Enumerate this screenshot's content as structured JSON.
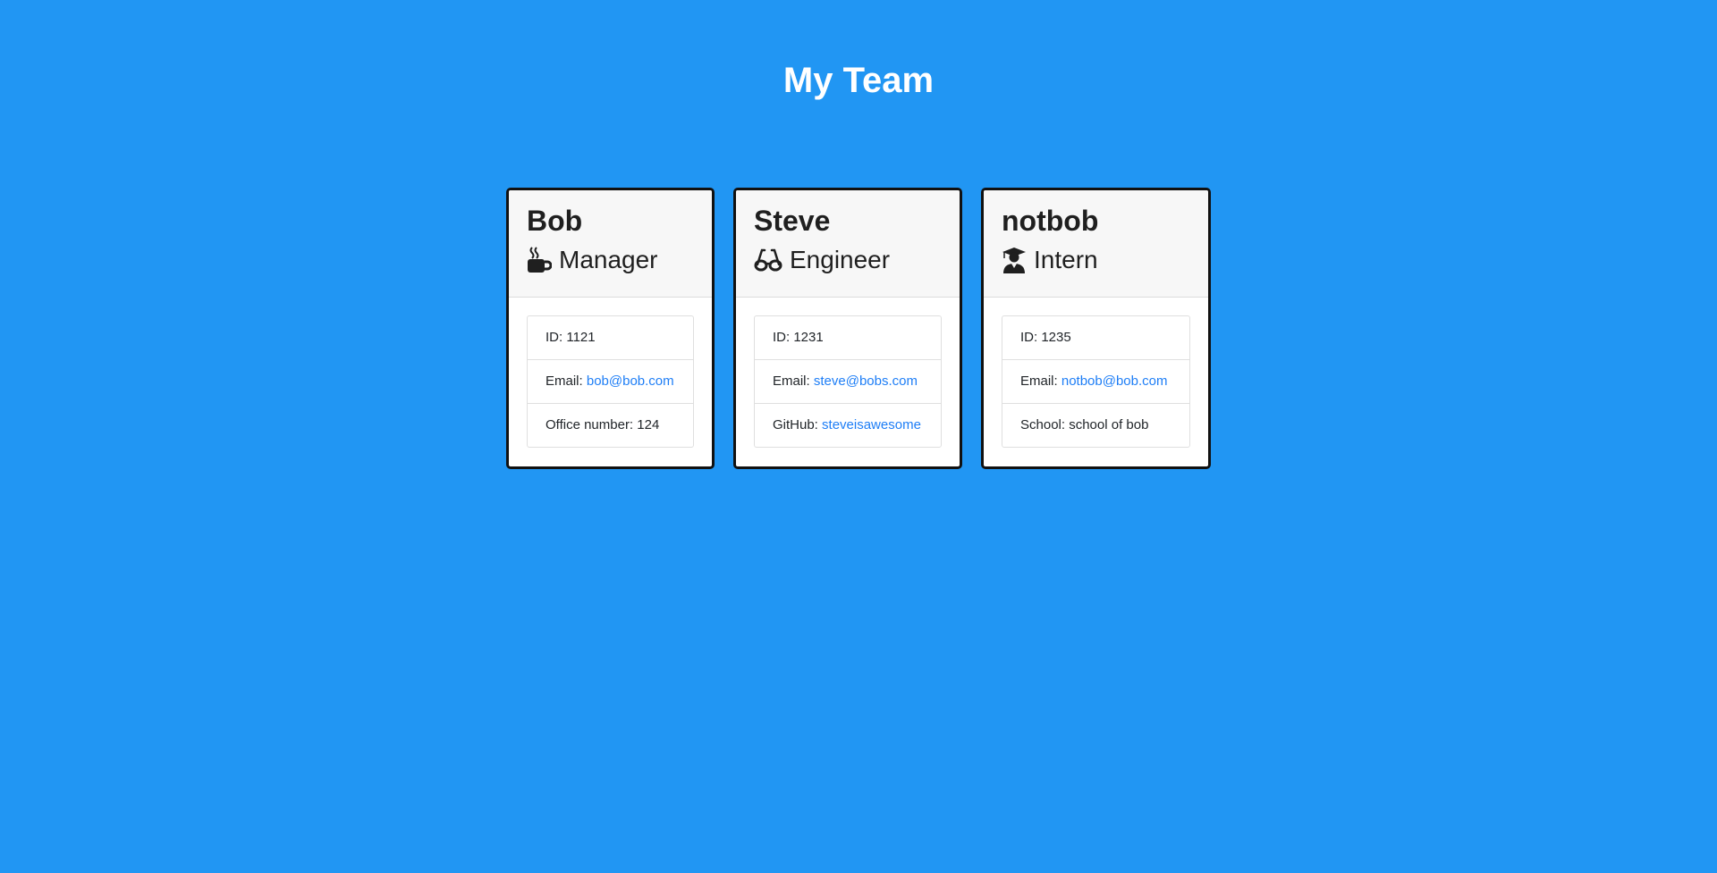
{
  "page": {
    "title": "My Team",
    "background_color": "#2196f3"
  },
  "cards": [
    {
      "name": "Bob",
      "role": "Manager",
      "role_icon": "coffee-mug-icon",
      "id_label": "ID:",
      "id_value": "1121",
      "email_label": "Email:",
      "email_value": "bob@bob.com",
      "extra_label": "Office number:",
      "extra_value": "124"
    },
    {
      "name": "Steve",
      "role": "Engineer",
      "role_icon": "glasses-icon",
      "id_label": "ID:",
      "id_value": "1231",
      "email_label": "Email:",
      "email_value": "steve@bobs.com",
      "extra_label": "GitHub:",
      "extra_value": "steveisawesome"
    },
    {
      "name": "notbob",
      "role": "Intern",
      "role_icon": "graduate-icon",
      "id_label": "ID:",
      "id_value": "1235",
      "email_label": "Email:",
      "email_value": "notbob@bob.com",
      "extra_label": "School:",
      "extra_value": "school of bob"
    }
  ],
  "colors": {
    "link": "#1e7ef6",
    "card_border": "#111111",
    "header_bg": "#f7f7f7"
  }
}
